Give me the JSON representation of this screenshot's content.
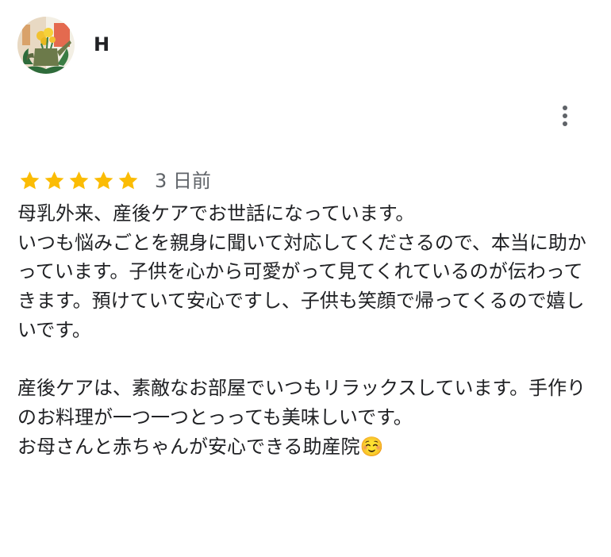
{
  "author": {
    "name": "H",
    "avatar_icon": "watering-can-flowers-avatar"
  },
  "menu": {
    "icon": "more-vertical-icon"
  },
  "rating": {
    "stars": 5,
    "max_stars": 5,
    "star_color": "#fbbc04",
    "date": "3 日前"
  },
  "review": {
    "text": "母乳外来、産後ケアでお世話になっています。\nいつも悩みごとを親身に聞いて対応してくださるので、本当に助かっています。子供を心から可愛がって見てくれているのが伝わってきます。預けていて安心ですし、子供も笑顔で帰ってくるので嬉しいです。\n\n産後ケアは、素敵なお部屋でいつもリラックスしています。手作りのお料理が一つ一つとっっても美味しいです。\nお母さんと赤ちゃんが安心できる助産院☺️"
  }
}
